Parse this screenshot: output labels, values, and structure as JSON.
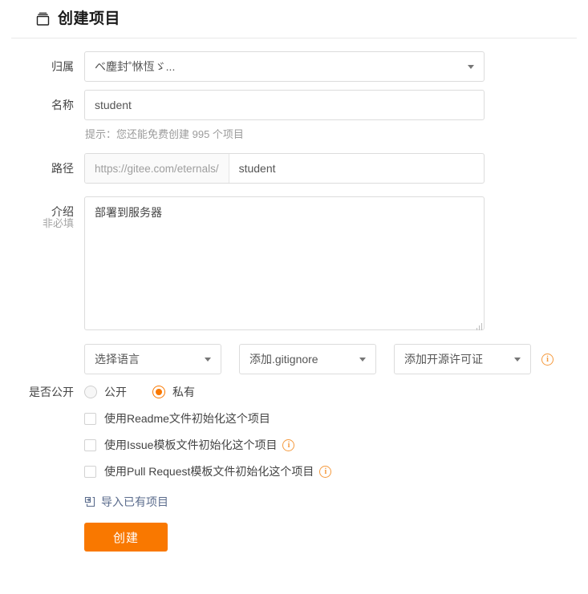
{
  "header": {
    "title": "创建项目",
    "icon": "repository-icon"
  },
  "form": {
    "owner": {
      "label": "归属",
      "value": "ベ塵封˚恘恆ゞ...",
      "caret_icon": "chevron-down-icon"
    },
    "name": {
      "label": "名称",
      "value": "student",
      "placeholder": "",
      "hint": "提示：您还能免费创建 995 个项目"
    },
    "path": {
      "label": "路径",
      "prefix": "https://gitee.com/eternals/",
      "value": "student",
      "placeholder": ""
    },
    "description": {
      "label": "介绍",
      "sub_label": "非必填",
      "value": "部署到服务器",
      "placeholder": ""
    },
    "options": [
      {
        "name": "language",
        "label": "选择语言",
        "caret_icon": "chevron-down-icon"
      },
      {
        "name": "gitignore",
        "label": "添加.gitignore",
        "caret_icon": "chevron-down-icon"
      },
      {
        "name": "license",
        "label": "添加开源许可证",
        "caret_icon": "chevron-down-icon"
      }
    ],
    "options_info_icon": "info-icon",
    "visibility": {
      "label": "是否公开",
      "choices": [
        {
          "label": "公开",
          "selected": false
        },
        {
          "label": "私有",
          "selected": true
        }
      ]
    },
    "checkboxes": [
      {
        "label": "使用Readme文件初始化这个项目",
        "checked": false,
        "info": false
      },
      {
        "label": "使用Issue模板文件初始化这个项目",
        "checked": false,
        "info": true
      },
      {
        "label": "使用Pull Request模板文件初始化这个项目",
        "checked": false,
        "info": true
      }
    ],
    "import_link": {
      "label": "导入已有项目",
      "icon": "import-icon"
    },
    "submit": {
      "label": "创建"
    }
  },
  "colors": {
    "accent": "#f97800",
    "info": "#f59a3e",
    "border": "#dcdcdc",
    "link": "#5a6b8c"
  }
}
